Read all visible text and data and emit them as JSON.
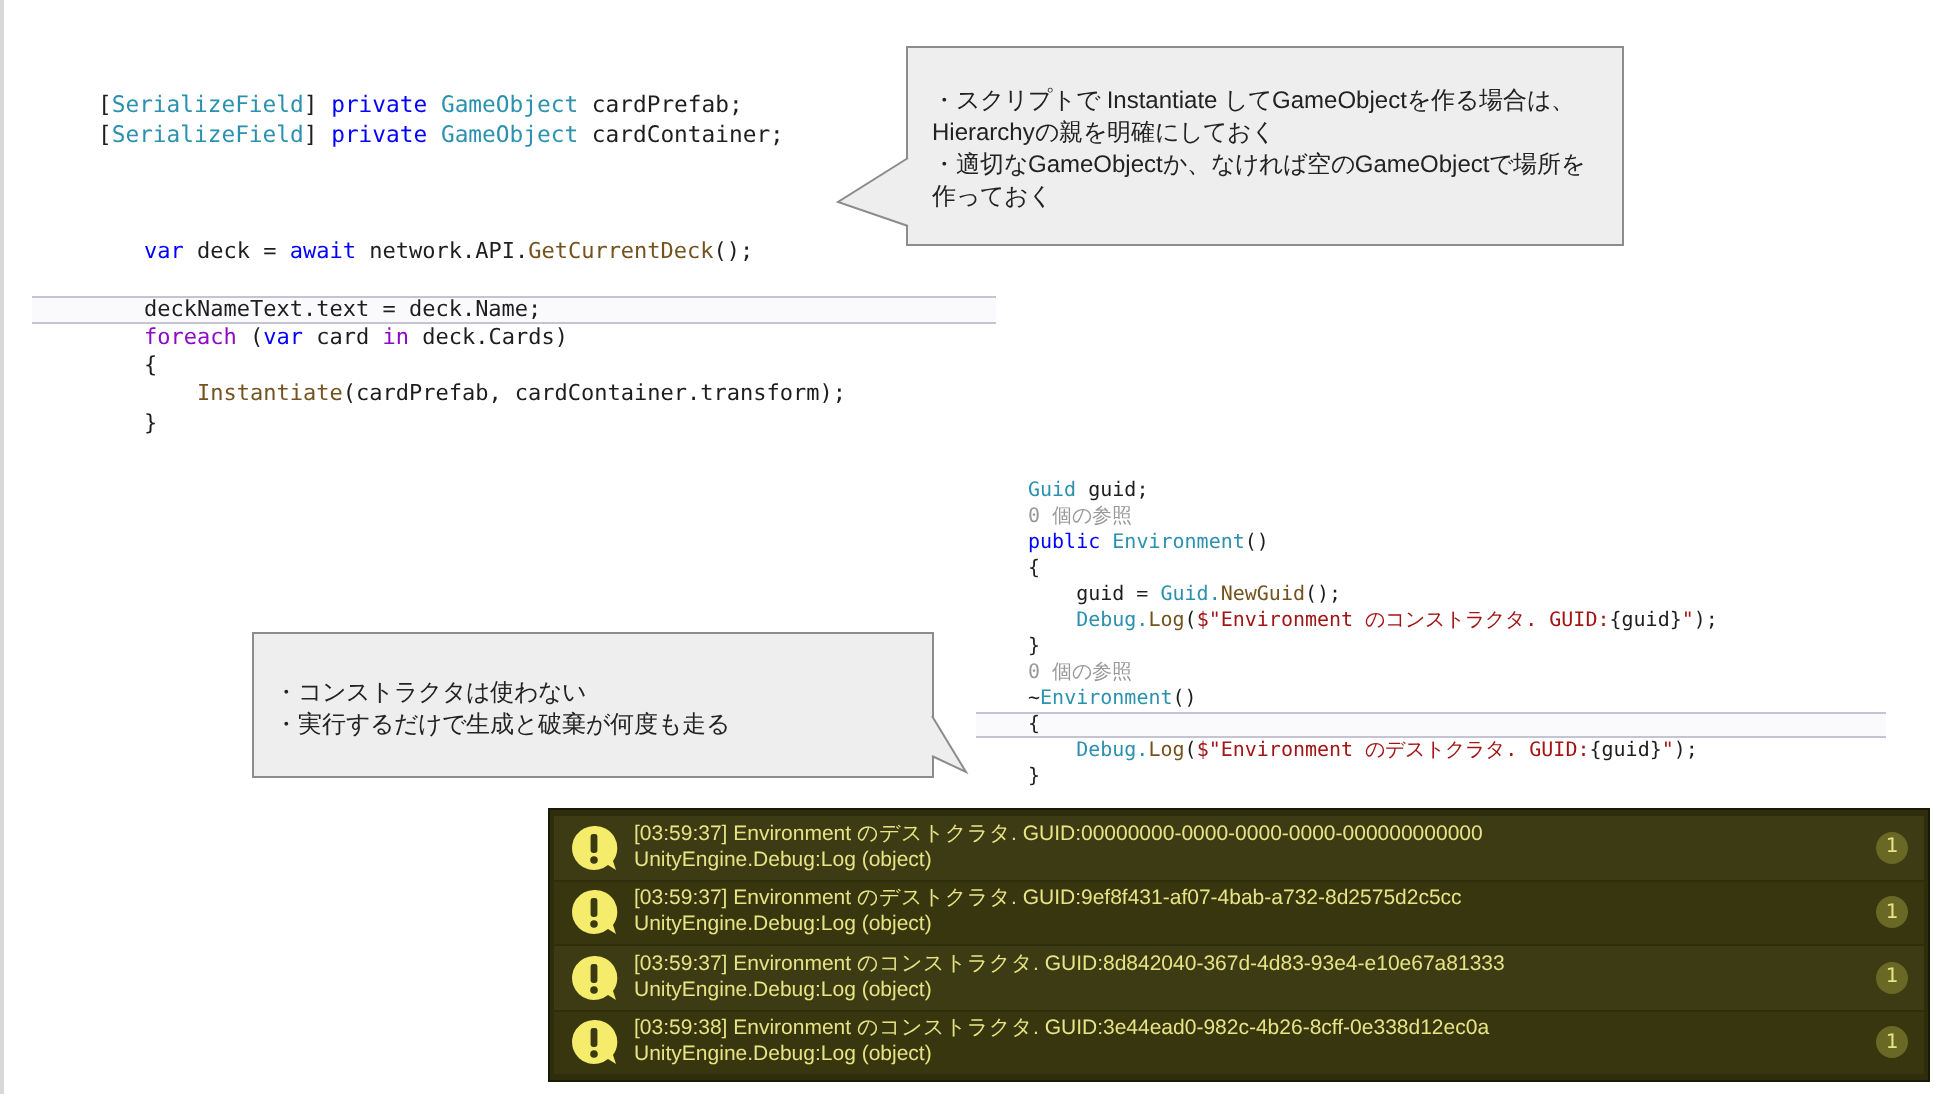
{
  "code_blocks": [
    {
      "lines": [
        {
          "kind": "code",
          "current": false,
          "segments": [
            {
              "text": "[",
              "kind": "plain"
            },
            {
              "text": "SerializeField",
              "kind": "type"
            },
            {
              "text": "] ",
              "kind": "plain"
            },
            {
              "text": "private ",
              "kind": "keyword"
            },
            {
              "text": "GameObject",
              "kind": "type"
            },
            {
              "text": " cardPrefab;",
              "kind": "plain"
            }
          ]
        },
        {
          "kind": "code",
          "current": false,
          "segments": [
            {
              "text": "[",
              "kind": "plain"
            },
            {
              "text": "SerializeField",
              "kind": "type"
            },
            {
              "text": "] ",
              "kind": "plain"
            },
            {
              "text": "private ",
              "kind": "keyword"
            },
            {
              "text": "GameObject",
              "kind": "type"
            },
            {
              "text": " cardContainer;",
              "kind": "plain"
            }
          ]
        }
      ]
    },
    {
      "lines": [
        {
          "kind": "code",
          "current": false,
          "segments": [
            {
              "text": "var",
              "kind": "keyword"
            },
            {
              "text": " deck = ",
              "kind": "plain"
            },
            {
              "text": "await",
              "kind": "keyword"
            },
            {
              "text": " network.API.",
              "kind": "plain"
            },
            {
              "text": "GetCurrentDeck",
              "kind": "method"
            },
            {
              "text": "();",
              "kind": "plain"
            }
          ]
        },
        {
          "kind": "blank",
          "current": false
        },
        {
          "kind": "code",
          "current": true,
          "segments": [
            {
              "text": "deckNameText.text = deck.Name;",
              "kind": "plain"
            }
          ]
        },
        {
          "kind": "code",
          "current": false,
          "segments": [
            {
              "text": "foreach",
              "kind": "control"
            },
            {
              "text": " (",
              "kind": "plain"
            },
            {
              "text": "var",
              "kind": "keyword"
            },
            {
              "text": " card ",
              "kind": "plain"
            },
            {
              "text": "in",
              "kind": "control"
            },
            {
              "text": " deck.Cards)",
              "kind": "plain"
            }
          ]
        },
        {
          "kind": "code",
          "current": false,
          "segments": [
            {
              "text": "{",
              "kind": "plain"
            }
          ]
        },
        {
          "kind": "code",
          "current": false,
          "segments": [
            {
              "text": "    Instantiate",
              "kind": "method"
            },
            {
              "text": "(cardPrefab, cardContainer.transform);",
              "kind": "plain"
            }
          ]
        },
        {
          "kind": "code",
          "current": false,
          "segments": [
            {
              "text": "}",
              "kind": "plain"
            }
          ]
        }
      ]
    },
    {
      "lines": [
        {
          "kind": "code",
          "current": false,
          "segments": [
            {
              "text": "Guid",
              "kind": "type"
            },
            {
              "text": " guid;",
              "kind": "plain"
            }
          ]
        },
        {
          "kind": "code",
          "current": false,
          "segments": [
            {
              "text": "0 個の参照",
              "kind": "hint"
            }
          ]
        },
        {
          "kind": "code",
          "current": false,
          "segments": [
            {
              "text": "public ",
              "kind": "keyword"
            },
            {
              "text": "Environment",
              "kind": "type"
            },
            {
              "text": "()",
              "kind": "plain"
            }
          ]
        },
        {
          "kind": "code",
          "current": false,
          "segments": [
            {
              "text": "{",
              "kind": "plain"
            }
          ]
        },
        {
          "kind": "code",
          "current": false,
          "segments": [
            {
              "text": "    guid = ",
              "kind": "plain"
            },
            {
              "text": "Guid.",
              "kind": "type"
            },
            {
              "text": "NewGuid",
              "kind": "method"
            },
            {
              "text": "();",
              "kind": "plain"
            }
          ]
        },
        {
          "kind": "code",
          "current": false,
          "segments": [
            {
              "text": "    Debug.",
              "kind": "type"
            },
            {
              "text": "Log",
              "kind": "method"
            },
            {
              "text": "(",
              "kind": "plain"
            },
            {
              "text": "$\"Environment のコンストラクタ. GUID:",
              "kind": "string"
            },
            {
              "text": "{guid}",
              "kind": "plain"
            },
            {
              "text": "\"",
              "kind": "string"
            },
            {
              "text": ");",
              "kind": "plain"
            }
          ]
        },
        {
          "kind": "code",
          "current": false,
          "segments": [
            {
              "text": "}",
              "kind": "plain"
            }
          ]
        },
        {
          "kind": "code",
          "current": false,
          "segments": [
            {
              "text": "0 個の参照",
              "kind": "hint"
            }
          ]
        },
        {
          "kind": "code",
          "current": false,
          "segments": [
            {
              "text": "~",
              "kind": "plain"
            },
            {
              "text": "Environment",
              "kind": "type"
            },
            {
              "text": "()",
              "kind": "plain"
            }
          ]
        },
        {
          "kind": "code",
          "current": true,
          "segments": [
            {
              "text": "{",
              "kind": "plain"
            }
          ]
        },
        {
          "kind": "code",
          "current": false,
          "segments": [
            {
              "text": "    Debug.",
              "kind": "type"
            },
            {
              "text": "Log",
              "kind": "method"
            },
            {
              "text": "(",
              "kind": "plain"
            },
            {
              "text": "$\"Environment のデストクラタ. GUID:",
              "kind": "string"
            },
            {
              "text": "{guid}",
              "kind": "plain"
            },
            {
              "text": "\"",
              "kind": "string"
            },
            {
              "text": ");",
              "kind": "plain"
            }
          ]
        },
        {
          "kind": "code",
          "current": false,
          "segments": [
            {
              "text": "}",
              "kind": "plain"
            }
          ]
        }
      ]
    }
  ],
  "callouts": [
    {
      "lines": [
        "・スクリプトで Instantiate してGameObjectを作る場合は、Hierarchyの親を明確にしておく",
        "・適切なGameObjectか、なければ空のGameObjectで場所を作っておく"
      ]
    },
    {
      "lines": [
        "・コンストラクタは使わない",
        "・実行するだけで生成と破棄が何度も走る"
      ]
    }
  ],
  "console": {
    "entries": [
      {
        "message": "[03:59:37] Environment のデストクラタ. GUID:00000000-0000-0000-0000-000000000000",
        "source": "UnityEngine.Debug:Log (object)",
        "count": "1"
      },
      {
        "message": "[03:59:37] Environment のデストクラタ. GUID:9ef8f431-af07-4bab-a732-8d2575d2c5cc",
        "source": "UnityEngine.Debug:Log (object)",
        "count": "1"
      },
      {
        "message": "[03:59:37] Environment のコンストラクタ. GUID:8d842040-367d-4d83-93e4-e10e67a81333",
        "source": "UnityEngine.Debug:Log (object)",
        "count": "1"
      },
      {
        "message": "[03:59:38] Environment のコンストラクタ. GUID:3e44ead0-982c-4b26-8cff-0e338d12ec0a",
        "source": "UnityEngine.Debug:Log (object)",
        "count": "1"
      }
    ]
  }
}
